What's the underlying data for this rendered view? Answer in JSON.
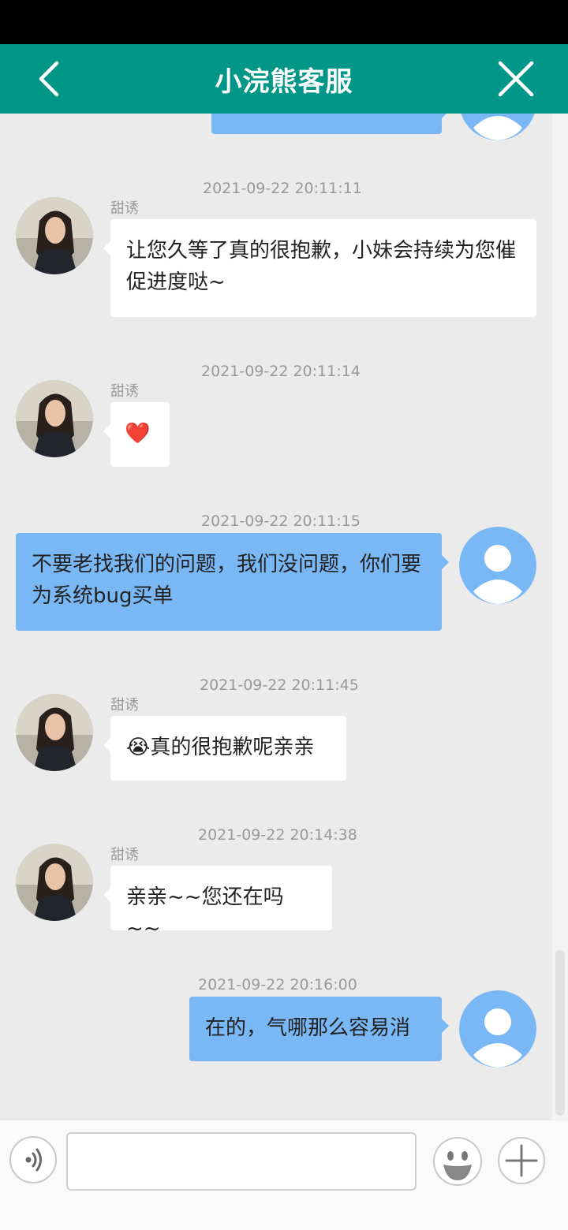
{
  "header": {
    "title": "小浣熊客服"
  },
  "messages": [
    {
      "time": "2021-09-22 20:11:11",
      "sender": "甜诱",
      "text": "让您久等了真的很抱歉，小妹会持续为您催促进度哒~"
    },
    {
      "time": "2021-09-22 20:11:14",
      "sender": "甜诱",
      "text": "❤️"
    },
    {
      "time": "2021-09-22 20:11:15",
      "text": "不要老找我们的问题，我们没问题，你们要为系统bug买单"
    },
    {
      "time": "2021-09-22 20:11:45",
      "sender": "甜诱",
      "text": "😭真的很抱歉呢亲亲"
    },
    {
      "time": "2021-09-22 20:14:38",
      "sender": "甜诱",
      "text": "亲亲~~您还在吗~~"
    },
    {
      "time": "2021-09-22 20:16:00",
      "text": "在的，气哪那么容易消"
    }
  ],
  "input": {
    "value": "",
    "placeholder": ""
  },
  "icons": {
    "back": "chevron-left-icon",
    "close": "close-icon",
    "voice": "voice-icon",
    "emoji": "emoji-icon",
    "plus": "plus-icon"
  },
  "colors": {
    "header": "#009688",
    "outgoing_bubble": "#7ab8f5",
    "incoming_bubble": "#ffffff",
    "background": "#ebebeb"
  }
}
